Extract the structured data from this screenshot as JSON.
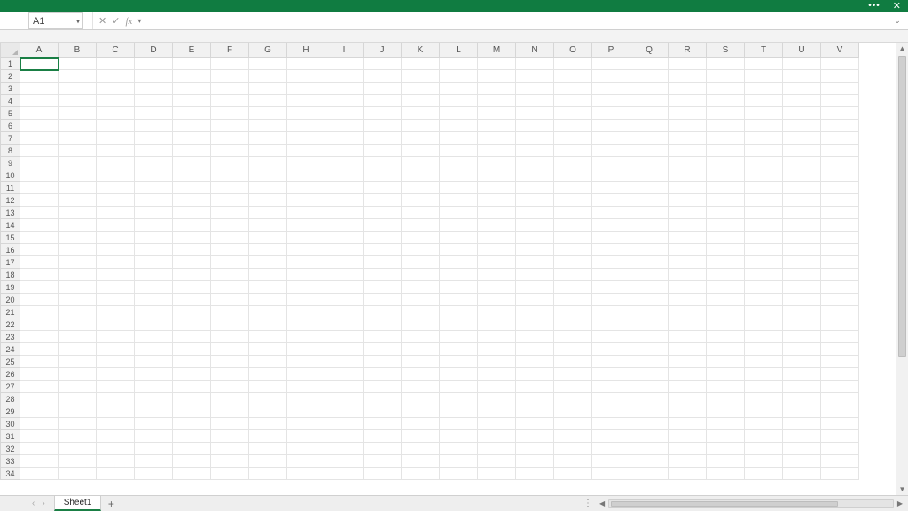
{
  "titlebar": {
    "more": "•••",
    "close": "✕"
  },
  "formula_bar": {
    "name_box": "A1",
    "cancel": "✕",
    "confirm": "✓",
    "fx": "fx",
    "value": ""
  },
  "grid": {
    "columns": [
      "A",
      "B",
      "C",
      "D",
      "E",
      "F",
      "G",
      "H",
      "I",
      "J",
      "K",
      "L",
      "M",
      "N",
      "O",
      "P",
      "Q",
      "R",
      "S",
      "T",
      "U",
      "V"
    ],
    "row_count": 34,
    "selected_cell": "A1"
  },
  "tabs": {
    "prev_disabled": "‹",
    "next_disabled": "›",
    "active": "Sheet1",
    "add": "+"
  }
}
